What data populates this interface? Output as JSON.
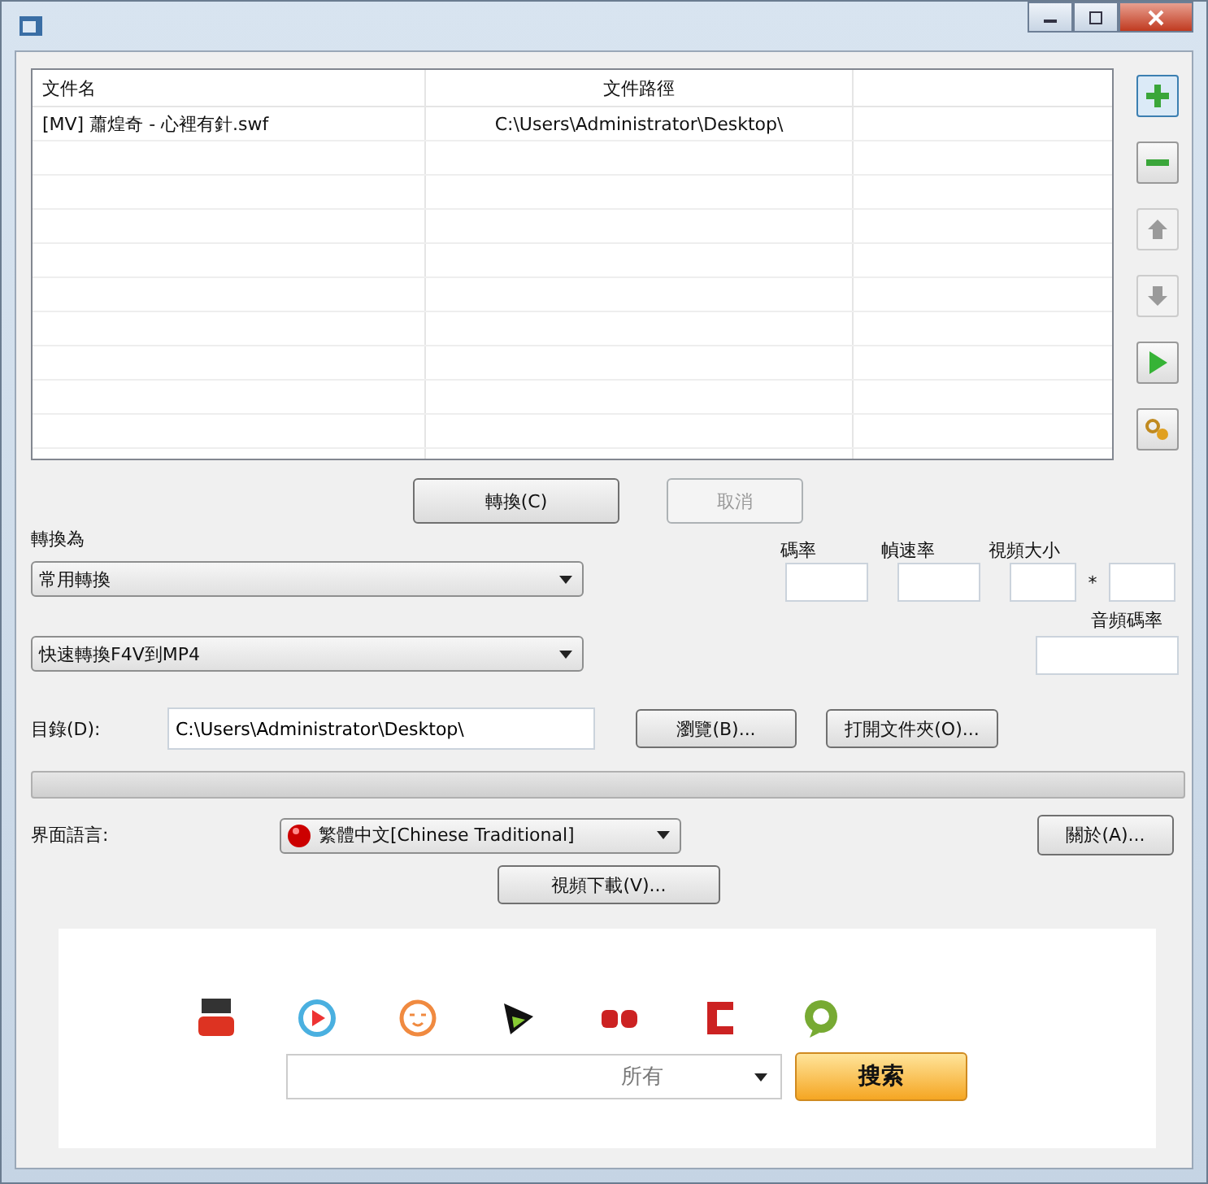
{
  "file_table": {
    "columns": [
      "文件名",
      "文件路徑"
    ],
    "rows": [
      {
        "name": "[MV] 蕭煌奇 - 心裡有針.swf",
        "path": "C:\\Users\\Administrator\\Desktop\\",
        "selected": false
      }
    ]
  },
  "side_buttons": [
    {
      "kind": "add",
      "disabled": false
    },
    {
      "kind": "remove",
      "disabled": false
    },
    {
      "kind": "up",
      "disabled": true
    },
    {
      "kind": "down",
      "disabled": true
    },
    {
      "kind": "play",
      "disabled": false
    },
    {
      "kind": "settings",
      "disabled": false
    }
  ],
  "convert_button": "轉換(C)",
  "cancel_button": {
    "label": "取消",
    "disabled": true
  },
  "convert_to": {
    "label": "轉換為",
    "category": "常用轉換",
    "preset": "快速轉換F4V到MP4"
  },
  "params": {
    "bitrate_label": "碼率",
    "framerate_label": "幀速率",
    "size_label": "視頻大小",
    "size_separator": "*",
    "audio_bitrate_label": "音頻碼率"
  },
  "directory": {
    "label": "目錄(D):",
    "value": "C:\\Users\\Administrator\\Desktop\\"
  },
  "browse_button": "瀏覽(B)...",
  "open_folder_button": "打開文件夾(O)...",
  "progress": {
    "level": 0
  },
  "language": {
    "label": "界面語言:",
    "value": "繁體中文[Chinese Traditional]"
  },
  "about_button": "關於(A)...",
  "download_button": "視頻下載(V)...",
  "search": {
    "sites": [
      {
        "kind": "tube"
      },
      {
        "kind": "play-circle"
      },
      {
        "kind": "face-circle"
      },
      {
        "kind": "arrow"
      },
      {
        "kind": "red-mark"
      },
      {
        "kind": "bracket"
      },
      {
        "kind": "green-circle"
      }
    ],
    "scope": "所有",
    "button": "搜索"
  }
}
